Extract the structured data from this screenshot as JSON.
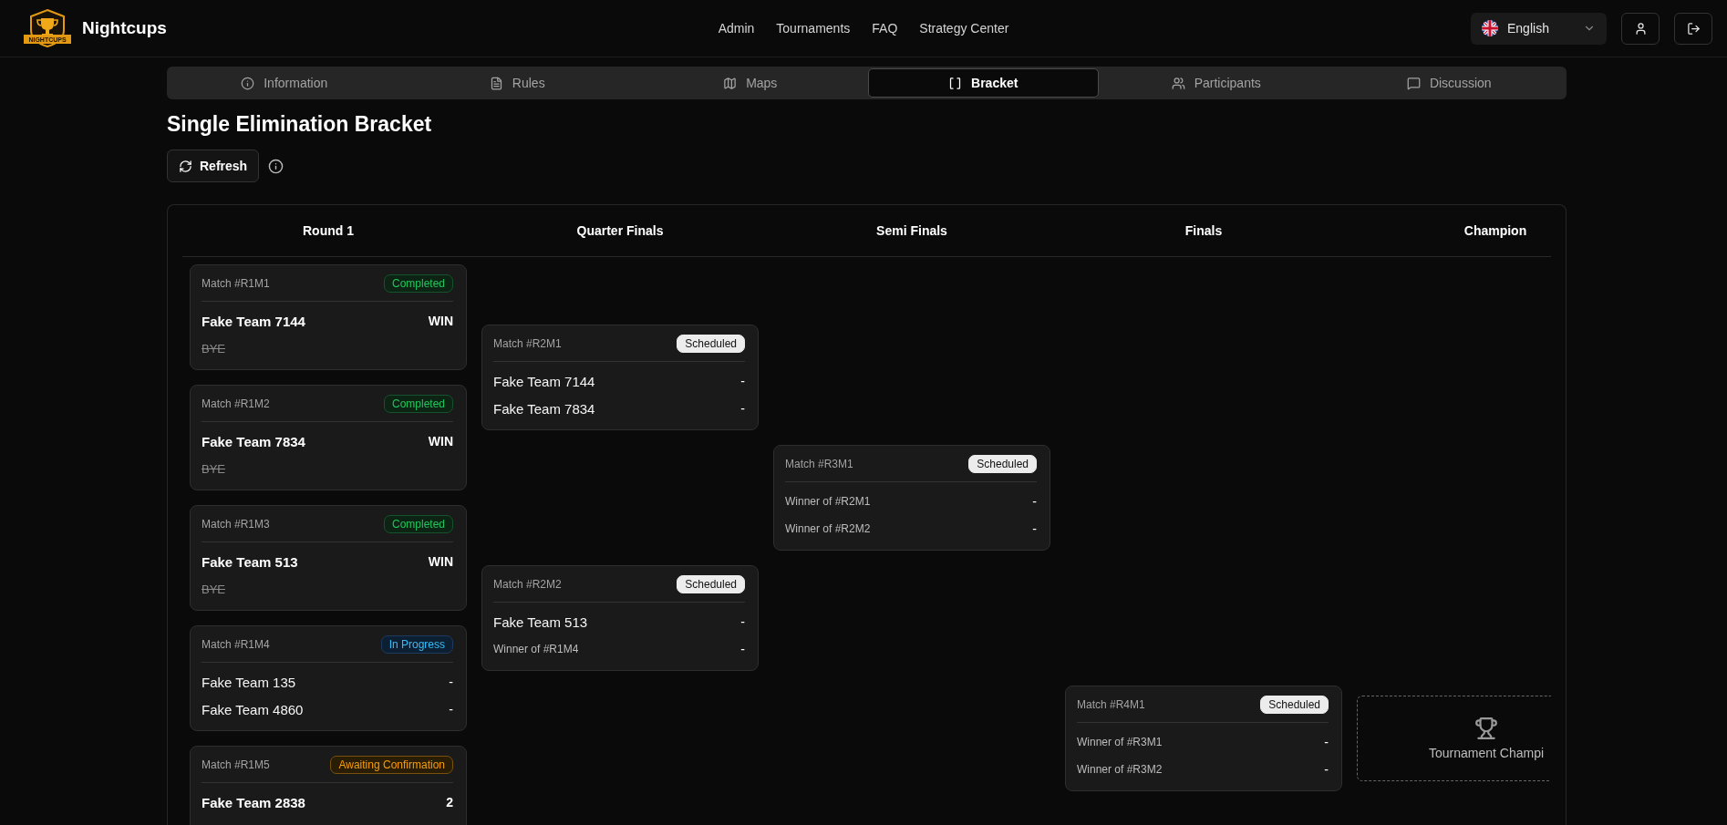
{
  "header": {
    "brand": "Nightcups",
    "logo_text": "NIGHTCUPS",
    "nav": [
      "Admin",
      "Tournaments",
      "FAQ",
      "Strategy Center"
    ],
    "language": "English"
  },
  "tabs": [
    {
      "label": "Information",
      "selected": false
    },
    {
      "label": "Rules",
      "selected": false
    },
    {
      "label": "Maps",
      "selected": false
    },
    {
      "label": "Bracket",
      "selected": true
    },
    {
      "label": "Participants",
      "selected": false
    },
    {
      "label": "Discussion",
      "selected": false
    }
  ],
  "title": "Single Elimination Bracket",
  "refresh_button": "Refresh",
  "bracket": {
    "rounds": [
      {
        "name": "Round 1",
        "matches": [
          {
            "id": "Match #R1M1",
            "status": "Completed",
            "kind": "completed",
            "teams": [
              {
                "name": "Fake Team 7144",
                "score": "WIN",
                "kind": "winner"
              },
              {
                "name": "BYE",
                "kind": "eliminated"
              }
            ]
          },
          {
            "id": "Match #R1M2",
            "status": "Completed",
            "kind": "completed",
            "teams": [
              {
                "name": "Fake Team 7834",
                "score": "WIN",
                "kind": "winner"
              },
              {
                "name": "BYE",
                "kind": "eliminated"
              }
            ]
          },
          {
            "id": "Match #R1M3",
            "status": "Completed",
            "kind": "completed",
            "teams": [
              {
                "name": "Fake Team 513",
                "score": "WIN",
                "kind": "winner"
              },
              {
                "name": "BYE",
                "kind": "eliminated"
              }
            ]
          },
          {
            "id": "Match #R1M4",
            "status": "In Progress",
            "kind": "in_progress",
            "teams": [
              {
                "name": "Fake Team 135",
                "score": "-",
                "kind": "team"
              },
              {
                "name": "Fake Team 4860",
                "score": "-",
                "kind": "team"
              }
            ]
          },
          {
            "id": "Match #R1M5",
            "status": "Awaiting Confirmation",
            "kind": "awaiting",
            "teams": [
              {
                "name": "Fake Team 2838",
                "score": "2",
                "kind": "winner"
              }
            ]
          }
        ]
      },
      {
        "name": "Quarter Finals",
        "matches": [
          {
            "id": "Match #R2M1",
            "status": "Scheduled",
            "kind": "scheduled",
            "teams": [
              {
                "name": "Fake Team 7144",
                "score": "-",
                "kind": "team"
              },
              {
                "name": "Fake Team 7834",
                "score": "-",
                "kind": "team"
              }
            ]
          },
          {
            "id": "Match #R2M2",
            "status": "Scheduled",
            "kind": "scheduled",
            "teams": [
              {
                "name": "Fake Team 513",
                "score": "-",
                "kind": "team"
              },
              {
                "name": "Winner of #R1M4",
                "score": "-",
                "kind": "placeholder"
              }
            ]
          }
        ]
      },
      {
        "name": "Semi Finals",
        "matches": [
          {
            "id": "Match #R3M1",
            "status": "Scheduled",
            "kind": "scheduled",
            "teams": [
              {
                "name": "Winner of #R2M1",
                "score": "-",
                "kind": "placeholder"
              },
              {
                "name": "Winner of #R2M2",
                "score": "-",
                "kind": "placeholder"
              }
            ]
          }
        ]
      },
      {
        "name": "Finals",
        "matches": [
          {
            "id": "Match #R4M1",
            "status": "Scheduled",
            "kind": "scheduled",
            "teams": [
              {
                "name": "Winner of #R3M1",
                "score": "-",
                "kind": "placeholder"
              },
              {
                "name": "Winner of #R3M2",
                "score": "-",
                "kind": "placeholder"
              }
            ]
          }
        ]
      }
    ],
    "champion": {
      "heading": "Champion",
      "label": "Tournament Champi"
    }
  }
}
